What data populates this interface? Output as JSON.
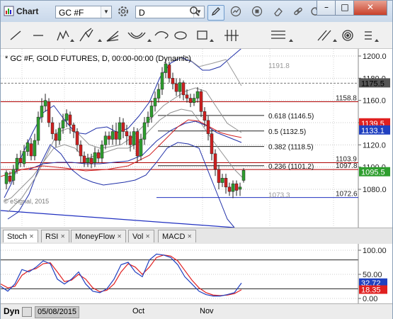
{
  "window": {
    "title": "Chart"
  },
  "toolbar": {
    "symbol": "GC #F",
    "interval": "D",
    "icons": [
      "settings-icon",
      "search-icon",
      "pencil-icon",
      "chart-style-icon",
      "stop-icon",
      "eraser-icon",
      "link-icon",
      "refresh-icon"
    ]
  },
  "draw_tools": [
    "trend-line-icon",
    "horizontal-line-icon",
    "zigzag-icon",
    "andrews-pitchfork-icon",
    "fibonacci-fan-icon",
    "arc-icon",
    "ellipse-icon",
    "rectangle-icon",
    "cycle-lines-icon",
    "fib-retracement-icon",
    "parallel-lines-icon",
    "target-icon",
    "menu-icon"
  ],
  "chart": {
    "header": "* GC #F, GOLD FUTURES, D, 00:00-00:00 (Dynamic)",
    "watermark": "© eSignal, 2015",
    "axis_ticks": [
      "1200.0",
      "1180.0",
      "1160.0",
      "1140.0",
      "1120.0",
      "1100.0",
      "1080.0"
    ],
    "price_labels": [
      {
        "text": "1175.5",
        "color": "#555555",
        "text_color": "#000000"
      },
      {
        "text": "1139.5",
        "color": "#e02020",
        "text_color": "#ffffff"
      },
      {
        "text": "1133.1",
        "color": "#2040c0",
        "text_color": "#ffffff"
      },
      {
        "text": "1095.5",
        "color": "#2e9e2e",
        "text_color": "#ffffff"
      }
    ],
    "levels": [
      "1158.8",
      "1103.9",
      "1097.8",
      "1072.6"
    ],
    "gray_levels": [
      "1191.8",
      "1073.3"
    ],
    "fib_labels": [
      "0.618 (1146.5)",
      "0.5 (1132.5)",
      "0.382 (1118.5)",
      "0.236 (1101.2)"
    ]
  },
  "tabs": [
    {
      "label": "Stoch",
      "active": true
    },
    {
      "label": "RSI",
      "active": false
    },
    {
      "label": "MoneyFlow",
      "active": false
    },
    {
      "label": "Vol",
      "active": false
    },
    {
      "label": "MACD",
      "active": false
    }
  ],
  "stoch": {
    "axis_ticks": [
      "100.00",
      "50.00",
      "0.00"
    ],
    "value_labels": [
      {
        "text": "32.72",
        "color": "#2040c0"
      },
      {
        "text": "18.35",
        "color": "#e02020"
      }
    ]
  },
  "bottom": {
    "dyn_label": "Dyn",
    "date": "05/08/2015",
    "months": [
      "Oct",
      "Nov"
    ]
  },
  "colors": {
    "up": "#2e9e2e",
    "down": "#d02020",
    "bb_blue": "#1f2fa8",
    "bb_gray": "#909090",
    "ma_red": "#d02020",
    "level_line": "#b00000"
  }
}
